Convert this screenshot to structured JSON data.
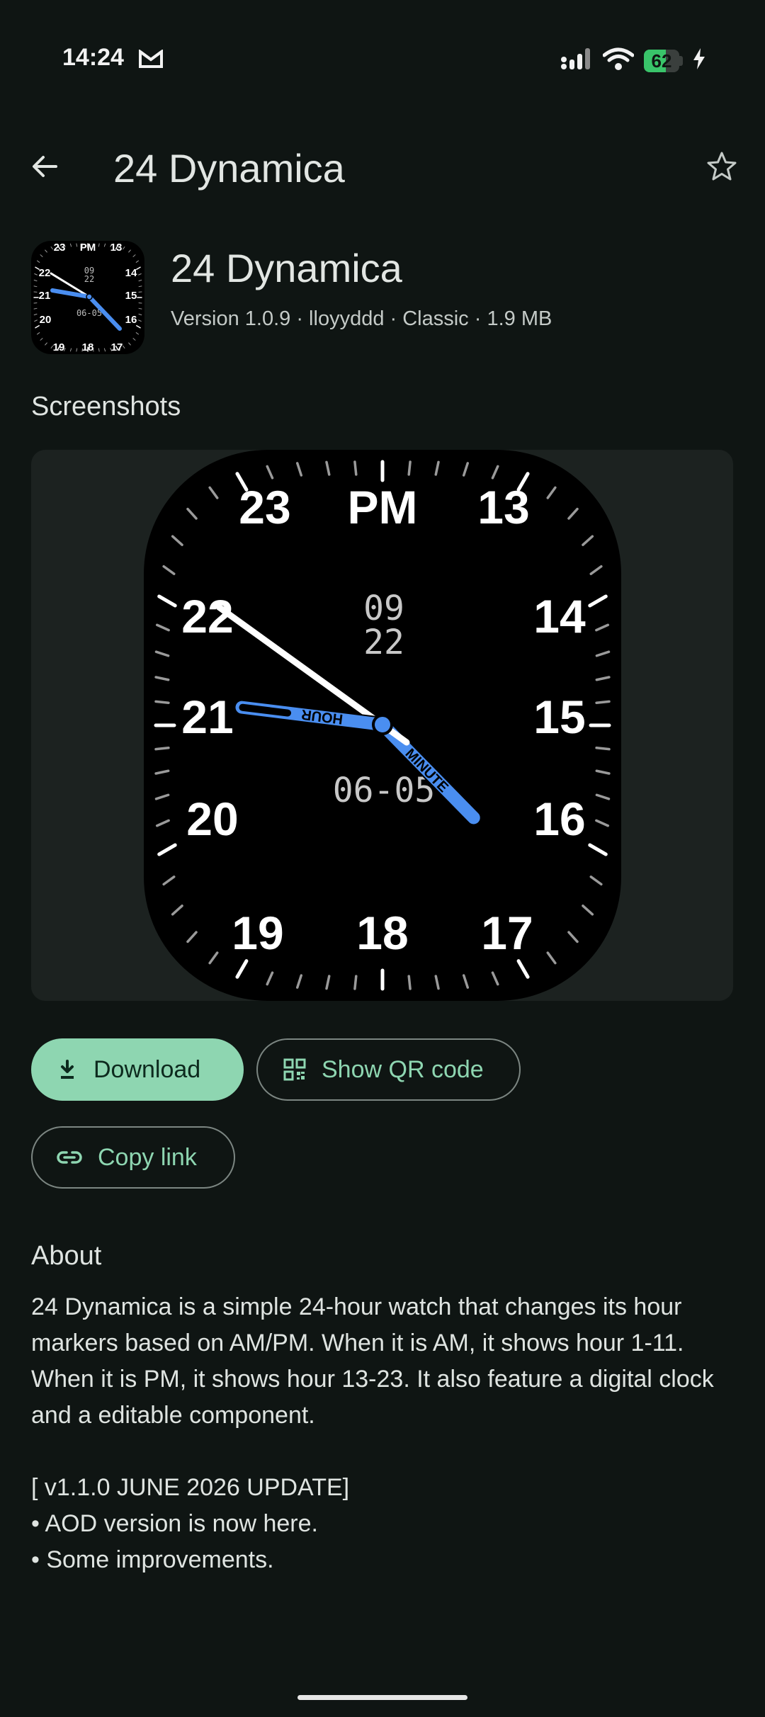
{
  "status_bar": {
    "time": "14:24",
    "battery_level": "62",
    "battery_percent": 62,
    "icons": [
      "mail-icon",
      "signal-icon",
      "wifi-icon",
      "battery-icon",
      "charging-bolt-icon"
    ]
  },
  "app_bar": {
    "title": "24 Dynamica",
    "back_icon": "arrow-back-icon",
    "favorite_icon": "star-outline-icon"
  },
  "header": {
    "name": "24 Dynamica",
    "meta": "Version 1.0.9 · lloyyddd · Classic · 1.9 MB"
  },
  "screenshots": {
    "title": "Screenshots",
    "watch_face": {
      "top_label": "PM",
      "hour_numbers": [
        "23",
        "13",
        "14",
        "15",
        "16",
        "17",
        "18",
        "19",
        "20",
        "21",
        "22"
      ],
      "digital_hour": "09",
      "digital_minute": "22",
      "date": "06-05",
      "hour_hand_label": "HOUR",
      "minute_hand_label": "MINUTE"
    }
  },
  "actions": {
    "download_label": "Download",
    "qr_label": "Show QR code",
    "copy_link_label": "Copy link"
  },
  "about": {
    "title": "About",
    "paragraph": "24 Dynamica is a simple 24-hour watch that changes its hour markers based on AM/PM. When it is AM, it shows hour 1-11. When it is PM, it shows hour 13-23. It also feature a digital clock and a editable component.",
    "update_title": "[ v1.1.0 JUNE 2026 UPDATE]",
    "update_items": [
      "• AOD version is now here.",
      "• Some improvements."
    ]
  },
  "colors": {
    "background": "#0f1513",
    "accent": "#8ed6b1",
    "hand_blue": "#4a8ef0",
    "card": "#1c2220"
  }
}
